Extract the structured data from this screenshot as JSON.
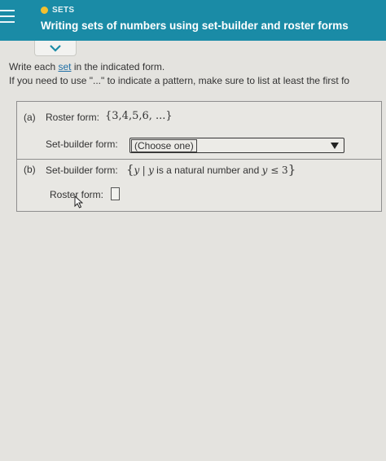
{
  "header": {
    "topic": "SETS",
    "title": "Writing sets of numbers using set-builder and roster forms",
    "topic_dot_color": "#f3c02f",
    "bar_color": "#1a8ba6"
  },
  "instructions": {
    "line1_prefix": "Write each ",
    "line1_link": "set",
    "line1_suffix": " in the indicated form.",
    "line2": "If you need to use \"...\" to indicate a pattern, make sure to list at least the first fo"
  },
  "part_a": {
    "letter": "(a)",
    "roster_label": "Roster form:",
    "roster_value": "{3,4,5,6, ...}",
    "setbuilder_label": "Set-builder form:",
    "dropdown_value": "(Choose one)"
  },
  "part_b": {
    "letter": "(b)",
    "setbuilder_label": "Set-builder form:",
    "open_brace": "{",
    "var1": "y",
    "bar": "|",
    "var2": "y",
    "condition": " is a natural number and ",
    "var3": "y",
    "le_three": " ≤ 3",
    "close_brace": "}",
    "roster_label": "Roster form:"
  }
}
